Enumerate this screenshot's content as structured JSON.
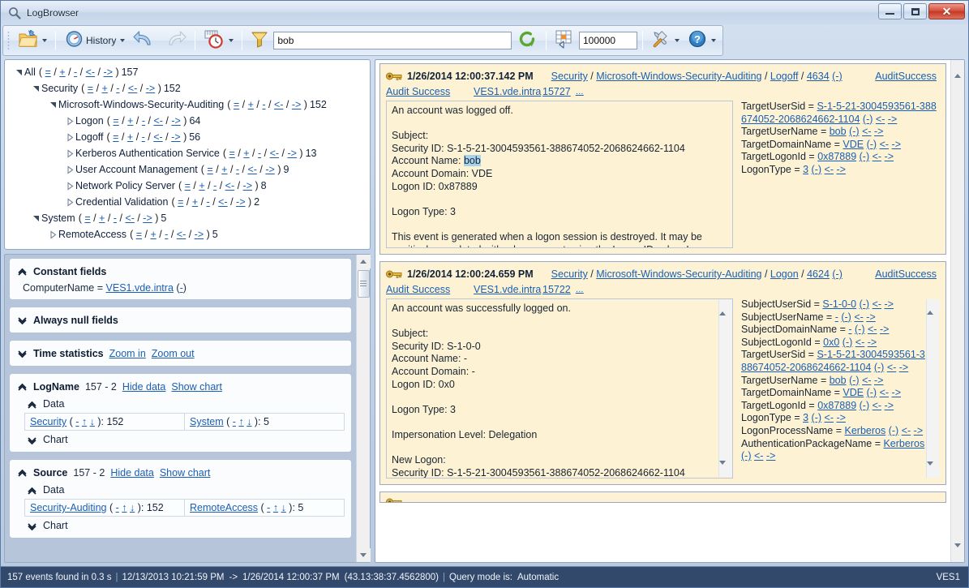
{
  "window": {
    "title": "LogBrowser",
    "title_icon": "magnifier-icon",
    "minimize": "minimize",
    "maximize": "maximize",
    "close": "close"
  },
  "toolbar": {
    "open_label": "",
    "open_icon": "open-folder-icon",
    "history_label": "History",
    "history_icon": "history-clock-icon",
    "undo_icon": "undo-arrow-icon",
    "redo_icon": "redo-arrow-icon",
    "time_icon": "time-range-icon",
    "filter_icon": "funnel-icon",
    "search_value": "bob",
    "search_placeholder": "",
    "refresh_icon": "refresh-icon",
    "limit_icon": "table-limit-icon",
    "limit_value": "100000",
    "tools_icon": "tools-icon",
    "help_icon": "help-icon"
  },
  "tree": {
    "ops": [
      "=",
      "+",
      "-",
      "<-",
      "->"
    ],
    "nodes": [
      {
        "indent": 0,
        "expanded": true,
        "label": "All",
        "count": "157"
      },
      {
        "indent": 1,
        "expanded": true,
        "label": "Security",
        "count": "152"
      },
      {
        "indent": 2,
        "expanded": true,
        "label": "Microsoft-Windows-Security-Auditing",
        "count": "152"
      },
      {
        "indent": 3,
        "expanded": false,
        "label": "Logon",
        "count": "64"
      },
      {
        "indent": 3,
        "expanded": false,
        "label": "Logoff",
        "count": "56"
      },
      {
        "indent": 3,
        "expanded": false,
        "label": "Kerberos Authentication Service",
        "count": "13"
      },
      {
        "indent": 3,
        "expanded": false,
        "label": "User Account Management",
        "count": "9"
      },
      {
        "indent": 3,
        "expanded": false,
        "label": "Network Policy Server",
        "count": "8"
      },
      {
        "indent": 3,
        "expanded": false,
        "label": "Credential Validation",
        "count": "2"
      },
      {
        "indent": 1,
        "expanded": true,
        "label": "System",
        "count": "5"
      },
      {
        "indent": 2,
        "expanded": false,
        "label": "RemoteAccess",
        "count": "5"
      }
    ]
  },
  "stats": {
    "constant_fields": {
      "title": "Constant fields",
      "expanded": true,
      "row_name": "ComputerName",
      "row_eq": "=",
      "row_value": "VES1.vde.intra",
      "row_op": "-"
    },
    "always_null": {
      "title": "Always null fields",
      "expanded": false
    },
    "time_statistics": {
      "title": "Time statistics",
      "expanded": false,
      "zoom_in": "Zoom in",
      "zoom_out": "Zoom out"
    },
    "logname": {
      "title": "LogName",
      "counts": "157 - 2",
      "hide_data": "Hide data",
      "show_chart": "Show chart",
      "data_label": "Data",
      "chart_label": "Chart",
      "items": [
        {
          "name": "Security",
          "ops": [
            "-",
            "↑",
            "↓"
          ],
          "value": "152"
        },
        {
          "name": "System",
          "ops": [
            "-",
            "↑",
            "↓"
          ],
          "value": "5"
        }
      ]
    },
    "source": {
      "title": "Source",
      "counts": "157 - 2",
      "hide_data": "Hide data",
      "show_chart": "Show chart",
      "data_label": "Data",
      "chart_label": "Chart",
      "items": [
        {
          "name": "Security-Auditing",
          "ops": [
            "-",
            "↑",
            "↓"
          ],
          "value": "152"
        },
        {
          "name": "RemoteAccess",
          "ops": [
            "-",
            "↑",
            "↓"
          ],
          "value": "5"
        }
      ]
    }
  },
  "events": [
    {
      "icon": "key-icon",
      "time": "1/26/2014 12:00:37.142 PM",
      "path": [
        "Security",
        "Microsoft-Windows-Security-Auditing",
        "Logoff",
        "4634"
      ],
      "path_op": "(-)",
      "result": "AuditSuccess",
      "keyword": "Audit Success",
      "computer": "VES1.vde.intra",
      "record_id": "15727",
      "more": "…",
      "description": "An account was logged off.\n\nSubject:\nSecurity ID: S-1-5-21-3004593561-388674052-2068624662-1104\nAccount Name: bob\nAccount Domain: VDE\nLogon ID: 0x87889\n\nLogon Type: 3\n\nThis event is generated when a logon session is destroyed. It may be positively correlated with a logon event using the Logon ID value. Logon IDs are only unique between reboots on the same computer.",
      "highlight": "bob",
      "desc_scroll": false,
      "fields_scroll": false,
      "fields": [
        {
          "name": "TargetUserSid",
          "value": "S-1-5-21-3004593561-388674052-2068624662-1104"
        },
        {
          "name": "TargetUserName",
          "value": "bob"
        },
        {
          "name": "TargetDomainName",
          "value": "VDE"
        },
        {
          "name": "TargetLogonId",
          "value": "0x87889"
        },
        {
          "name": "LogonType",
          "value": "3"
        }
      ]
    },
    {
      "icon": "key-icon",
      "time": "1/26/2014 12:00:24.659 PM",
      "path": [
        "Security",
        "Microsoft-Windows-Security-Auditing",
        "Logon",
        "4624"
      ],
      "path_op": "(-)",
      "result": "AuditSuccess",
      "keyword": "Audit Success",
      "computer": "VES1.vde.intra",
      "record_id": "15722",
      "more": "…",
      "description": "An account was successfully logged on.\n\nSubject:\nSecurity ID: S-1-0-0\nAccount Name: -\nAccount Domain: -\nLogon ID: 0x0\n\nLogon Type: 3\n\nImpersonation Level: Delegation\n\nNew Logon:\nSecurity ID: S-1-5-21-3004593561-388674052-2068624662-1104",
      "highlight": "",
      "desc_scroll": true,
      "fields_scroll": true,
      "fields": [
        {
          "name": "SubjectUserSid",
          "value": "S-1-0-0"
        },
        {
          "name": "SubjectUserName",
          "value": "-"
        },
        {
          "name": "SubjectDomainName",
          "value": "-"
        },
        {
          "name": "SubjectLogonId",
          "value": "0x0"
        },
        {
          "name": "TargetUserSid",
          "value": "S-1-5-21-3004593561-388674052-2068624662-1104"
        },
        {
          "name": "TargetUserName",
          "value": "bob"
        },
        {
          "name": "TargetDomainName",
          "value": "VDE"
        },
        {
          "name": "TargetLogonId",
          "value": "0x87889"
        },
        {
          "name": "LogonType",
          "value": "3"
        },
        {
          "name": "LogonProcessName",
          "value": "Kerberos"
        },
        {
          "name": "AuthenticationPackageName",
          "value": "Kerberos"
        }
      ]
    }
  ],
  "field_ops": {
    "dash": "(-)",
    "prev": "<-",
    "next": "->"
  },
  "statusbar": {
    "events_found": "157 events found in 0.3 s",
    "range_start": "12/13/2013 10:21:59 PM",
    "arrow": "->",
    "range_end": "1/26/2014 12:00:37 PM",
    "duration": "(43.13:38:37.4562800)",
    "query_mode_label": "Query mode is:",
    "query_mode_value": "Automatic",
    "server": "VES1"
  }
}
